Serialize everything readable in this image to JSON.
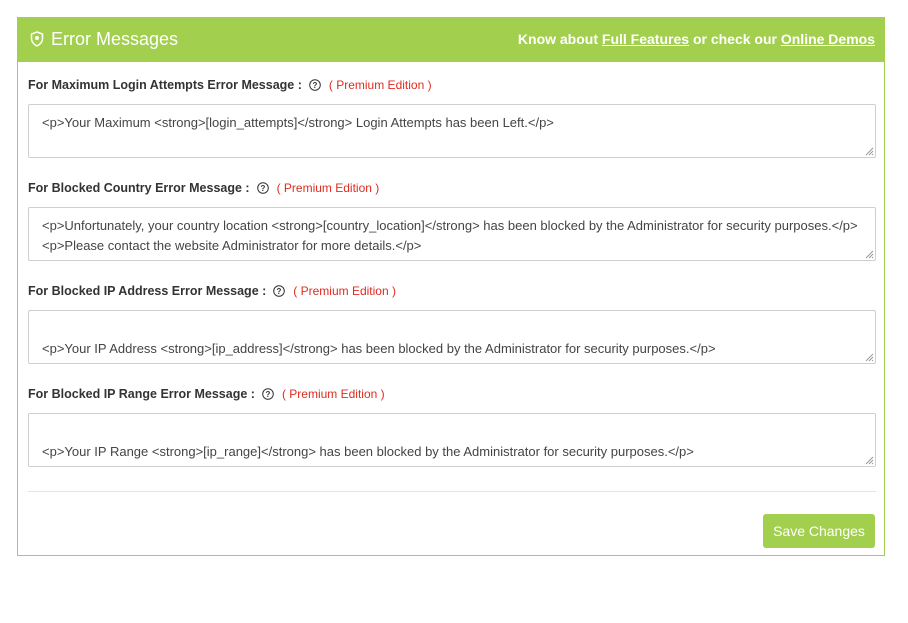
{
  "header": {
    "title": "Error Messages",
    "icon": "shield-icon",
    "promo_prefix": "Know about",
    "promo_link1": "Full Features",
    "promo_middle": "or check our",
    "promo_link2": "Online Demos"
  },
  "fields": [
    {
      "label": "For Maximum Login Attempts Error Message :",
      "badge": "( Premium Edition )",
      "value": "<p>Your Maximum <strong>[login_attempts]</strong> Login Attempts has been Left.</p>"
    },
    {
      "label": "For Blocked Country Error Message :",
      "badge": "( Premium Edition )",
      "value": "<p>Unfortunately, your country location <strong>[country_location]</strong> has been blocked by the Administrator for security purposes.</p><p>Please contact the website Administrator for more details.</p>"
    },
    {
      "label": "For Blocked IP Address Error Message :",
      "badge": "( Premium Edition )",
      "value": "<p>Your IP Address <strong>[ip_address]</strong> has been blocked by the Administrator for security purposes.</p>\n<p>Please contact the website Administrator for more details.</p>"
    },
    {
      "label": "For Blocked IP Range Error Message :",
      "badge": "( Premium Edition )",
      "value": "<p>Your IP Range <strong>[ip_range]</strong> has been blocked by the Administrator for security purposes.</p>\n<p>Please contact the website Administrator for more details.</p>"
    }
  ],
  "save_label": "Save Changes",
  "colors": {
    "accent": "#a2cf4e",
    "premium": "#e02b20",
    "border": "#cfcfcf"
  }
}
